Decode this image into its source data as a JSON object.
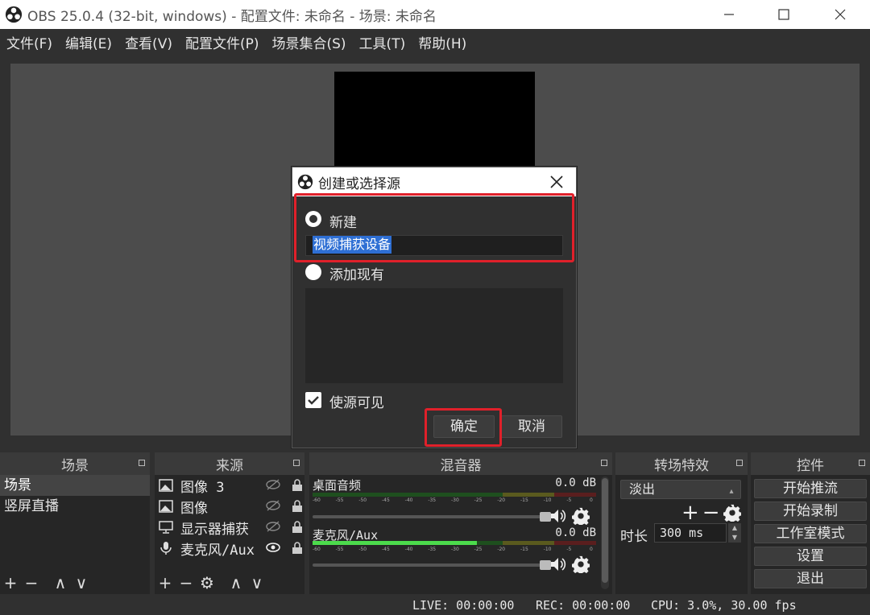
{
  "window": {
    "title": "OBS 25.0.4 (32-bit, windows) - 配置文件: 未命名 - 场景: 未命名"
  },
  "menu": [
    "文件(F)",
    "编辑(E)",
    "查看(V)",
    "配置文件(P)",
    "场景集合(S)",
    "工具(T)",
    "帮助(H)"
  ],
  "scenes": {
    "header": "场景",
    "items": [
      "场景",
      "竖屏直播"
    ]
  },
  "sources": {
    "header": "来源",
    "items": [
      {
        "icon": "image-icon",
        "label": "图像 3"
      },
      {
        "icon": "image-icon",
        "label": "图像"
      },
      {
        "icon": "monitor-icon",
        "label": "显示器捕获"
      },
      {
        "icon": "microphone-icon",
        "label": "麦克风/Aux"
      }
    ]
  },
  "mixer": {
    "header": "混音器",
    "ticks": [
      "-60",
      "-55",
      "-50",
      "-45",
      "-40",
      "-35",
      "-30",
      "-25",
      "-20",
      "-15",
      "-10",
      "-5",
      "0"
    ],
    "channels": [
      {
        "name": "桌面音频",
        "db": "0.0 dB",
        "level": 0.0
      },
      {
        "name": "麦克风/Aux",
        "db": "0.0 dB",
        "level": 0.58
      }
    ]
  },
  "transitions": {
    "header": "转场特效",
    "selected": "淡出",
    "duration_label": "时长",
    "duration_value": "300 ms"
  },
  "controls": {
    "header": "控件",
    "buttons": [
      "开始推流",
      "开始录制",
      "工作室模式",
      "设置",
      "退出"
    ]
  },
  "status": {
    "live": "LIVE: 00:00:00",
    "rec": "REC: 00:00:00",
    "cpu": "CPU: 3.0%, 30.00 fps"
  },
  "dialog": {
    "title": "创建或选择源",
    "new_label": "新建",
    "name_value": "视频捕获设备",
    "existing_label": "添加现有",
    "visible_label": "使源可见",
    "ok": "确定",
    "cancel": "取消"
  },
  "colors": {
    "highlight": "#e0202a",
    "selection": "#2e6fd4",
    "meter_green": "#4cdb4c"
  }
}
